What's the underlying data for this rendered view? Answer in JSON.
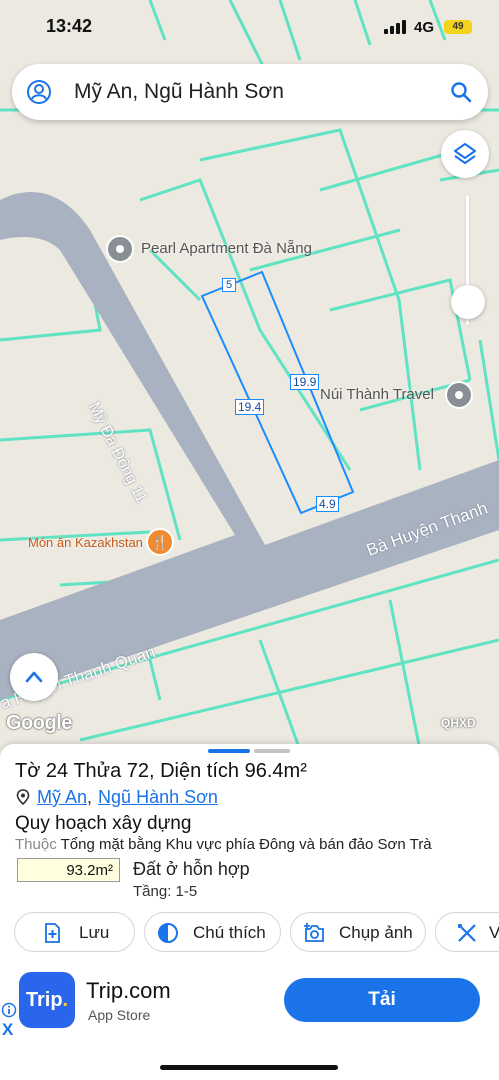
{
  "status": {
    "time": "13:42",
    "network": "4G",
    "battery": "49"
  },
  "search": {
    "query": "Mỹ An, Ngũ Hành Sơn"
  },
  "map": {
    "pois": {
      "pearl": "Pearl Apartment Đà Nẵng",
      "travel": "Núi Thành Travel",
      "food": "Món ăn Kazakhstan"
    },
    "streets": {
      "my_da_dong": "Mỹ Đa Đông 11",
      "ba_huyen_right": "Bà Huyện Thanh",
      "ba_huyen_left": "a Huyện Thanh Quan"
    },
    "parcel_dims": {
      "top": "5",
      "left": "19.4",
      "right": "19.9",
      "bottom": "4.9"
    },
    "google_label": "Google",
    "layer_label": "QHXD",
    "colors": {
      "road": "#a8b2c0",
      "lot_lines": "#5fe3c2",
      "parcel": "#1a8cff"
    }
  },
  "sheet": {
    "title_prefix": "Tờ ",
    "sheet_no": "24",
    "plot_prefix": " Thửa ",
    "plot_no": "72",
    "area_prefix": ", Diện tích ",
    "area_value": "96.4m²",
    "ward": "Mỹ An",
    "comma": ",",
    "district": "Ngũ Hành Sơn",
    "section": "Quy hoạch xây dựng",
    "belongs_label": "Thuộc",
    "belongs_value": " Tổng mặt bằng Khu vực phía Đông và bán đảo Sơn Trà",
    "zone_area": "93.2m²",
    "zone_use": "Đất ở hỗn hợp",
    "floors": "Tầng: 1-5",
    "actions": {
      "save": "Lưu",
      "legend": "Chú thích",
      "photo": "Chụp ảnh",
      "measure": "V"
    }
  },
  "ad": {
    "logo_main": "Trip",
    "logo_dot": ".",
    "name": "Trip.com",
    "store": "App Store",
    "cta": "Tải",
    "close": "X"
  }
}
